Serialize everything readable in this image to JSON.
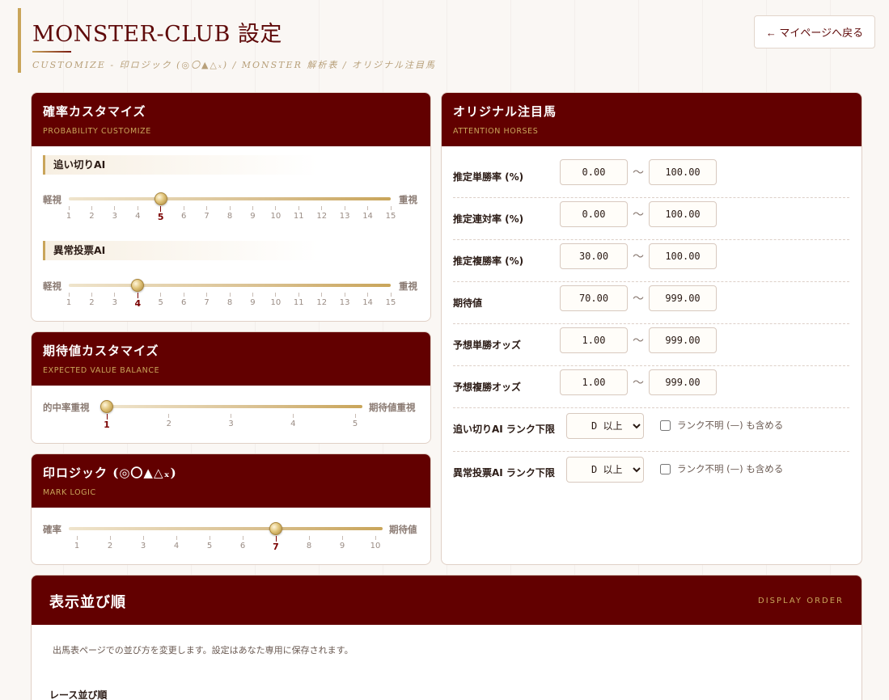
{
  "header": {
    "title": "MONSTER-CLUB 設定",
    "subtitle": "CUSTOMIZE - 印ロジック (◎〇▲△ₓ) / MONSTER 解析表 / オリジナル注目馬",
    "back_label": "← マイページへ戻る"
  },
  "probability": {
    "title": "確率カスタマイズ",
    "subtitle": "PROBABILITY CUSTOMIZE",
    "sliders": [
      {
        "label": "追い切りAI",
        "left": "軽視",
        "right": "重視",
        "min": 1,
        "max": 15,
        "value": 5,
        "ticks": [
          "1",
          "2",
          "3",
          "4",
          "5",
          "6",
          "7",
          "8",
          "9",
          "10",
          "11",
          "12",
          "13",
          "14",
          "15"
        ]
      },
      {
        "label": "異常投票AI",
        "left": "軽視",
        "right": "重視",
        "min": 1,
        "max": 15,
        "value": 4,
        "ticks": [
          "1",
          "2",
          "3",
          "4",
          "5",
          "6",
          "7",
          "8",
          "9",
          "10",
          "11",
          "12",
          "13",
          "14",
          "15"
        ]
      }
    ]
  },
  "expected": {
    "title": "期待値カスタマイズ",
    "subtitle": "EXPECTED VALUE BALANCE",
    "slider": {
      "left": "的中率重視",
      "right": "期待値重視",
      "min": 1,
      "max": 5,
      "value": 1,
      "ticks": [
        "1",
        "2",
        "3",
        "4",
        "5"
      ]
    }
  },
  "mark": {
    "title": "印ロジック (◎〇▲△ₓ)",
    "subtitle": "MARK LOGIC",
    "slider": {
      "left": "確率",
      "right": "期待値",
      "min": 1,
      "max": 10,
      "value": 7,
      "ticks": [
        "1",
        "2",
        "3",
        "4",
        "5",
        "6",
        "7",
        "8",
        "9",
        "10"
      ]
    }
  },
  "attention": {
    "title": "オリジナル注目馬",
    "subtitle": "ATTENTION HORSES",
    "tilde": "〜",
    "ranges": [
      {
        "label": "推定単勝率 (%)",
        "min": "0.00",
        "max": "100.00"
      },
      {
        "label": "推定連対率 (%)",
        "min": "0.00",
        "max": "100.00"
      },
      {
        "label": "推定複勝率 (%)",
        "min": "30.00",
        "max": "100.00"
      },
      {
        "label": "期待値",
        "min": "70.00",
        "max": "999.00"
      },
      {
        "label": "予想単勝オッズ",
        "min": "1.00",
        "max": "999.00"
      },
      {
        "label": "予想複勝オッズ",
        "min": "1.00",
        "max": "999.00"
      }
    ],
    "ranks": [
      {
        "label": "追い切りAI ランク下限",
        "value": "D 以上",
        "check_label": "ランク不明 (—) も含める",
        "checked": false
      },
      {
        "label": "異常投票AI ランク下限",
        "value": "D 以上",
        "check_label": "ランク不明 (—) も含める",
        "checked": false
      }
    ]
  },
  "order": {
    "title": "表示並び順",
    "subtitle": "DISPLAY ORDER",
    "description": "出馬表ページでの並び方を変更します。設定はあなた専用に保存されます。",
    "race_label": "レース並び順"
  }
}
